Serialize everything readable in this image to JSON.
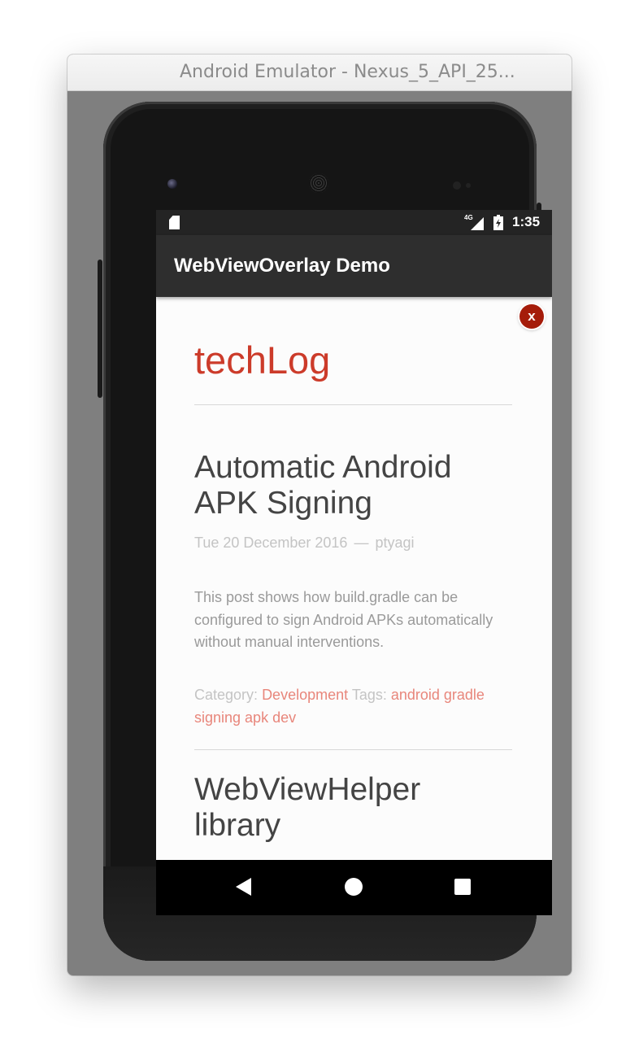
{
  "window": {
    "title": "Android Emulator - Nexus_5_API_25..."
  },
  "status_bar": {
    "time": "1:35",
    "network_type": "4G",
    "icons": [
      "sd-card-icon",
      "signal-icon",
      "battery-charging-icon"
    ]
  },
  "app_bar": {
    "title": "WebViewOverlay Demo"
  },
  "overlay": {
    "close_label": "x"
  },
  "blog": {
    "title": "techLog",
    "posts": [
      {
        "title": "Automatic Android APK Signing",
        "date": "Tue 20 December 2016",
        "separator": "—",
        "author": "ptyagi",
        "excerpt": "This post shows how build.gradle can be configured to sign Android APKs automatically without manual interventions.",
        "category_label": "Category:",
        "category": "Development",
        "tags_label": "Tags:",
        "tags": "android gradle signing apk dev"
      },
      {
        "title": "WebViewHelper library"
      }
    ]
  },
  "nav_bar": {
    "icons": [
      "back-icon",
      "home-icon",
      "recents-icon"
    ]
  },
  "colors": {
    "accent": "#cc3b2a",
    "link": "#e8867b",
    "close_button": "#a51c0a",
    "app_bar": "#2e2e2e"
  }
}
